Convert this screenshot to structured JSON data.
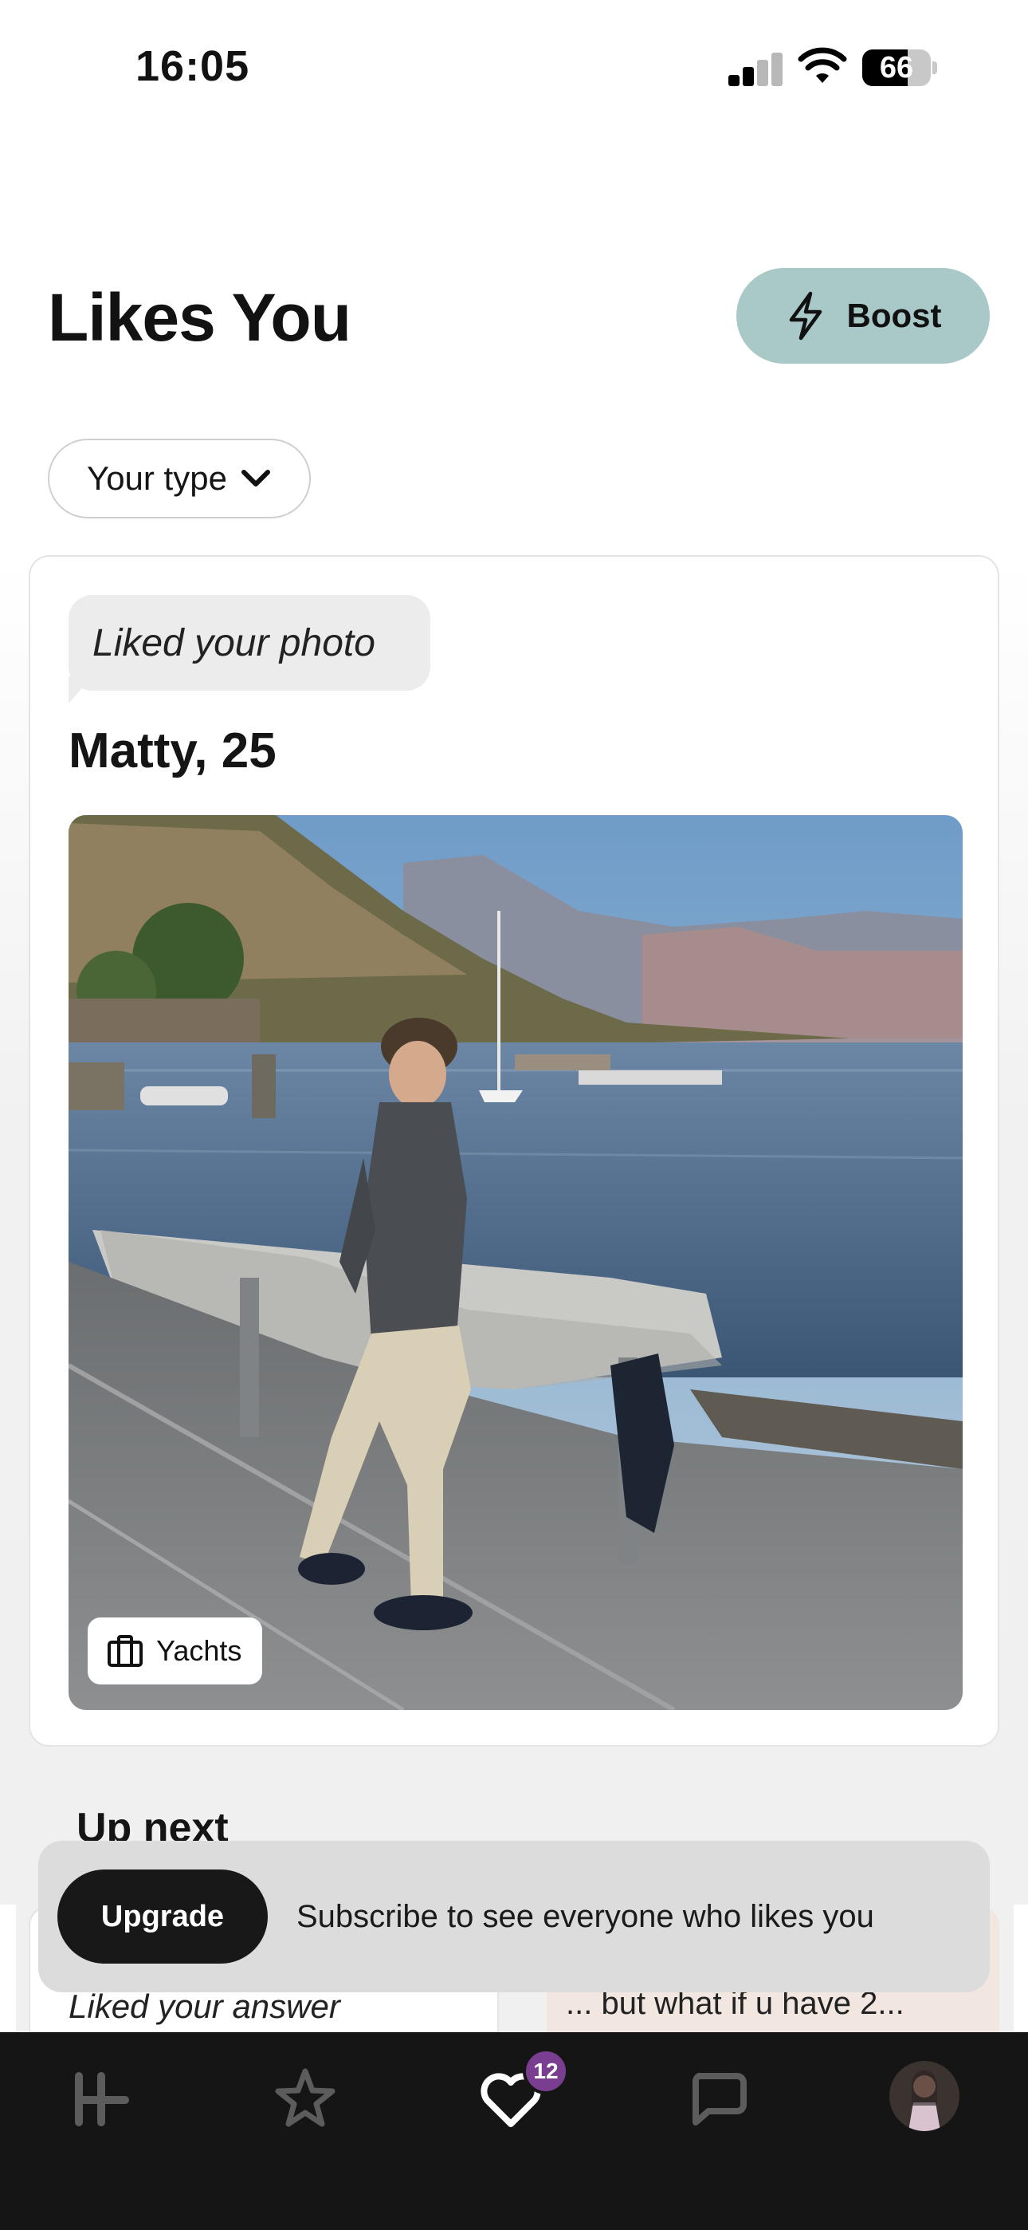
{
  "status_bar": {
    "time": "16:05",
    "battery": "66",
    "battery_level": 0.66
  },
  "header": {
    "title": "Likes You",
    "boost_label": "Boost",
    "boost_icon": "lightning-icon"
  },
  "filter": {
    "label": "Your type",
    "icon": "chevron-down-icon"
  },
  "like_card": {
    "context": "Liked your photo",
    "name_age": "Matty, 25",
    "photo_tag": {
      "label": "Yachts",
      "icon": "briefcase-icon"
    }
  },
  "up_next": {
    "heading": "Up next",
    "cards": [
      {
        "text": "Liked your answer"
      },
      {
        "text": "... but what if u have 2..."
      }
    ]
  },
  "upgrade_banner": {
    "button_label": "Upgrade",
    "text": "Subscribe to see everyone who likes you"
  },
  "tab_bar": {
    "items": [
      {
        "name": "home",
        "icon": "hinge-logo-icon"
      },
      {
        "name": "standouts",
        "icon": "star-icon"
      },
      {
        "name": "likes-you",
        "icon": "heart-icon",
        "badge": "12",
        "active": true
      },
      {
        "name": "matches",
        "icon": "chat-bubble-icon"
      },
      {
        "name": "profile",
        "icon": "avatar"
      }
    ]
  }
}
